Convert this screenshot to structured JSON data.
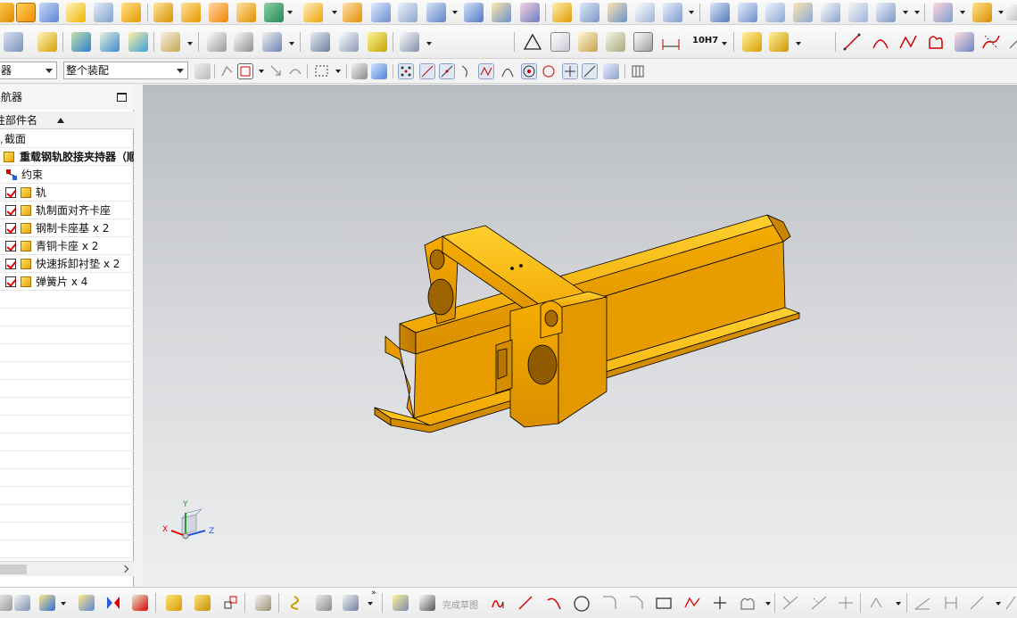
{
  "toolbar": {
    "combo_left_value": "器",
    "combo_assembly_value": "整个装配"
  },
  "navigator": {
    "title": "导航器",
    "column_header": "性部件名",
    "items": [
      {
        "label": "截面",
        "type": "section"
      },
      {
        "label": "重载钢轨胶接夹持器（顺",
        "type": "assembly"
      },
      {
        "label": "约束",
        "type": "constraints"
      },
      {
        "label": "轨",
        "type": "part",
        "checked": true
      },
      {
        "label": "轨制面对齐卡座",
        "type": "part",
        "checked": true
      },
      {
        "label": "钢制卡座基 x 2",
        "type": "part",
        "checked": true
      },
      {
        "label": "青铜卡座 x 2",
        "type": "part",
        "checked": true
      },
      {
        "label": "快速拆卸衬垫 x 2",
        "type": "part",
        "checked": true
      },
      {
        "label": "弹簧片 x 4",
        "type": "part",
        "checked": true
      }
    ]
  },
  "triad": {
    "x": "X",
    "y": "Y",
    "z": "Z"
  },
  "bottombar": {
    "finish_sketch_label": "完成草图",
    "tool_label": "10H7"
  },
  "colors": {
    "part_fill": "#f5a800",
    "part_light": "#ffc21a",
    "part_dark": "#c37f00",
    "edge": "#000000"
  }
}
